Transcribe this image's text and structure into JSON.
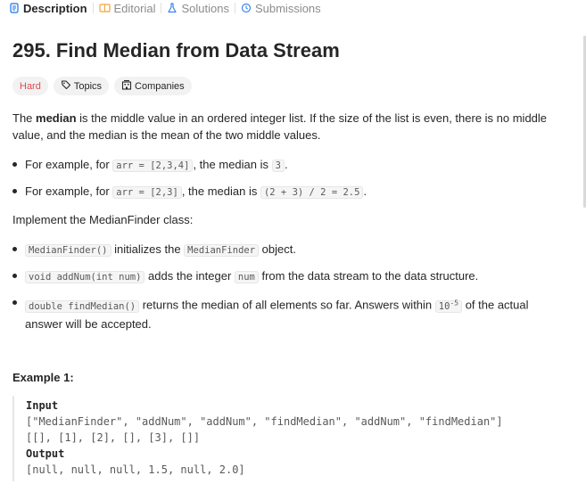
{
  "tabs": [
    {
      "label": "Description",
      "icon": "document-icon"
    },
    {
      "label": "Editorial",
      "icon": "book-icon"
    },
    {
      "label": "Solutions",
      "icon": "flask-icon"
    },
    {
      "label": "Submissions",
      "icon": "history-icon"
    }
  ],
  "problem": {
    "title": "295. Find Median from Data Stream",
    "difficulty": "Hard",
    "topics_label": "Topics",
    "companies_label": "Companies",
    "colors": {
      "hard": "#e5484d"
    }
  },
  "description": {
    "intro_pre": "The ",
    "intro_bold": "median",
    "intro_post": " is the middle value in an ordered integer list. If the size of the list is even, there is no middle value, and the median is the mean of the two middle values.",
    "examples": [
      {
        "pre": "For example, for ",
        "code1": "arr = [2,3,4]",
        "mid": ", the median is ",
        "code2": "3",
        "post": "."
      },
      {
        "pre": "For example, for ",
        "code1": "arr = [2,3]",
        "mid": ", the median is ",
        "code2": "(2 + 3) / 2 = 2.5",
        "post": "."
      }
    ],
    "implement": "Implement the MedianFinder class:",
    "methods": [
      {
        "code": "MedianFinder()",
        "text1": " initializes the ",
        "code2": "MedianFinder",
        "text2": " object."
      },
      {
        "code": "void addNum(int num)",
        "text1": " adds the integer ",
        "code2": "num",
        "text2": " from the data stream to the data structure."
      },
      {
        "code": "double findMedian()",
        "text1": " returns the median of all elements so far. Answers within ",
        "code2": "10",
        "sup": "-5",
        "text2": " of the actual answer will be accepted."
      }
    ]
  },
  "example1": {
    "title": "Example 1:",
    "input_label": "Input",
    "input_line1": "[\"MedianFinder\", \"addNum\", \"addNum\", \"findMedian\", \"addNum\", \"findMedian\"]",
    "input_line2": "[[], [1], [2], [], [3], []]",
    "output_label": "Output",
    "output_line": "[null, null, null, 1.5, null, 2.0]"
  }
}
